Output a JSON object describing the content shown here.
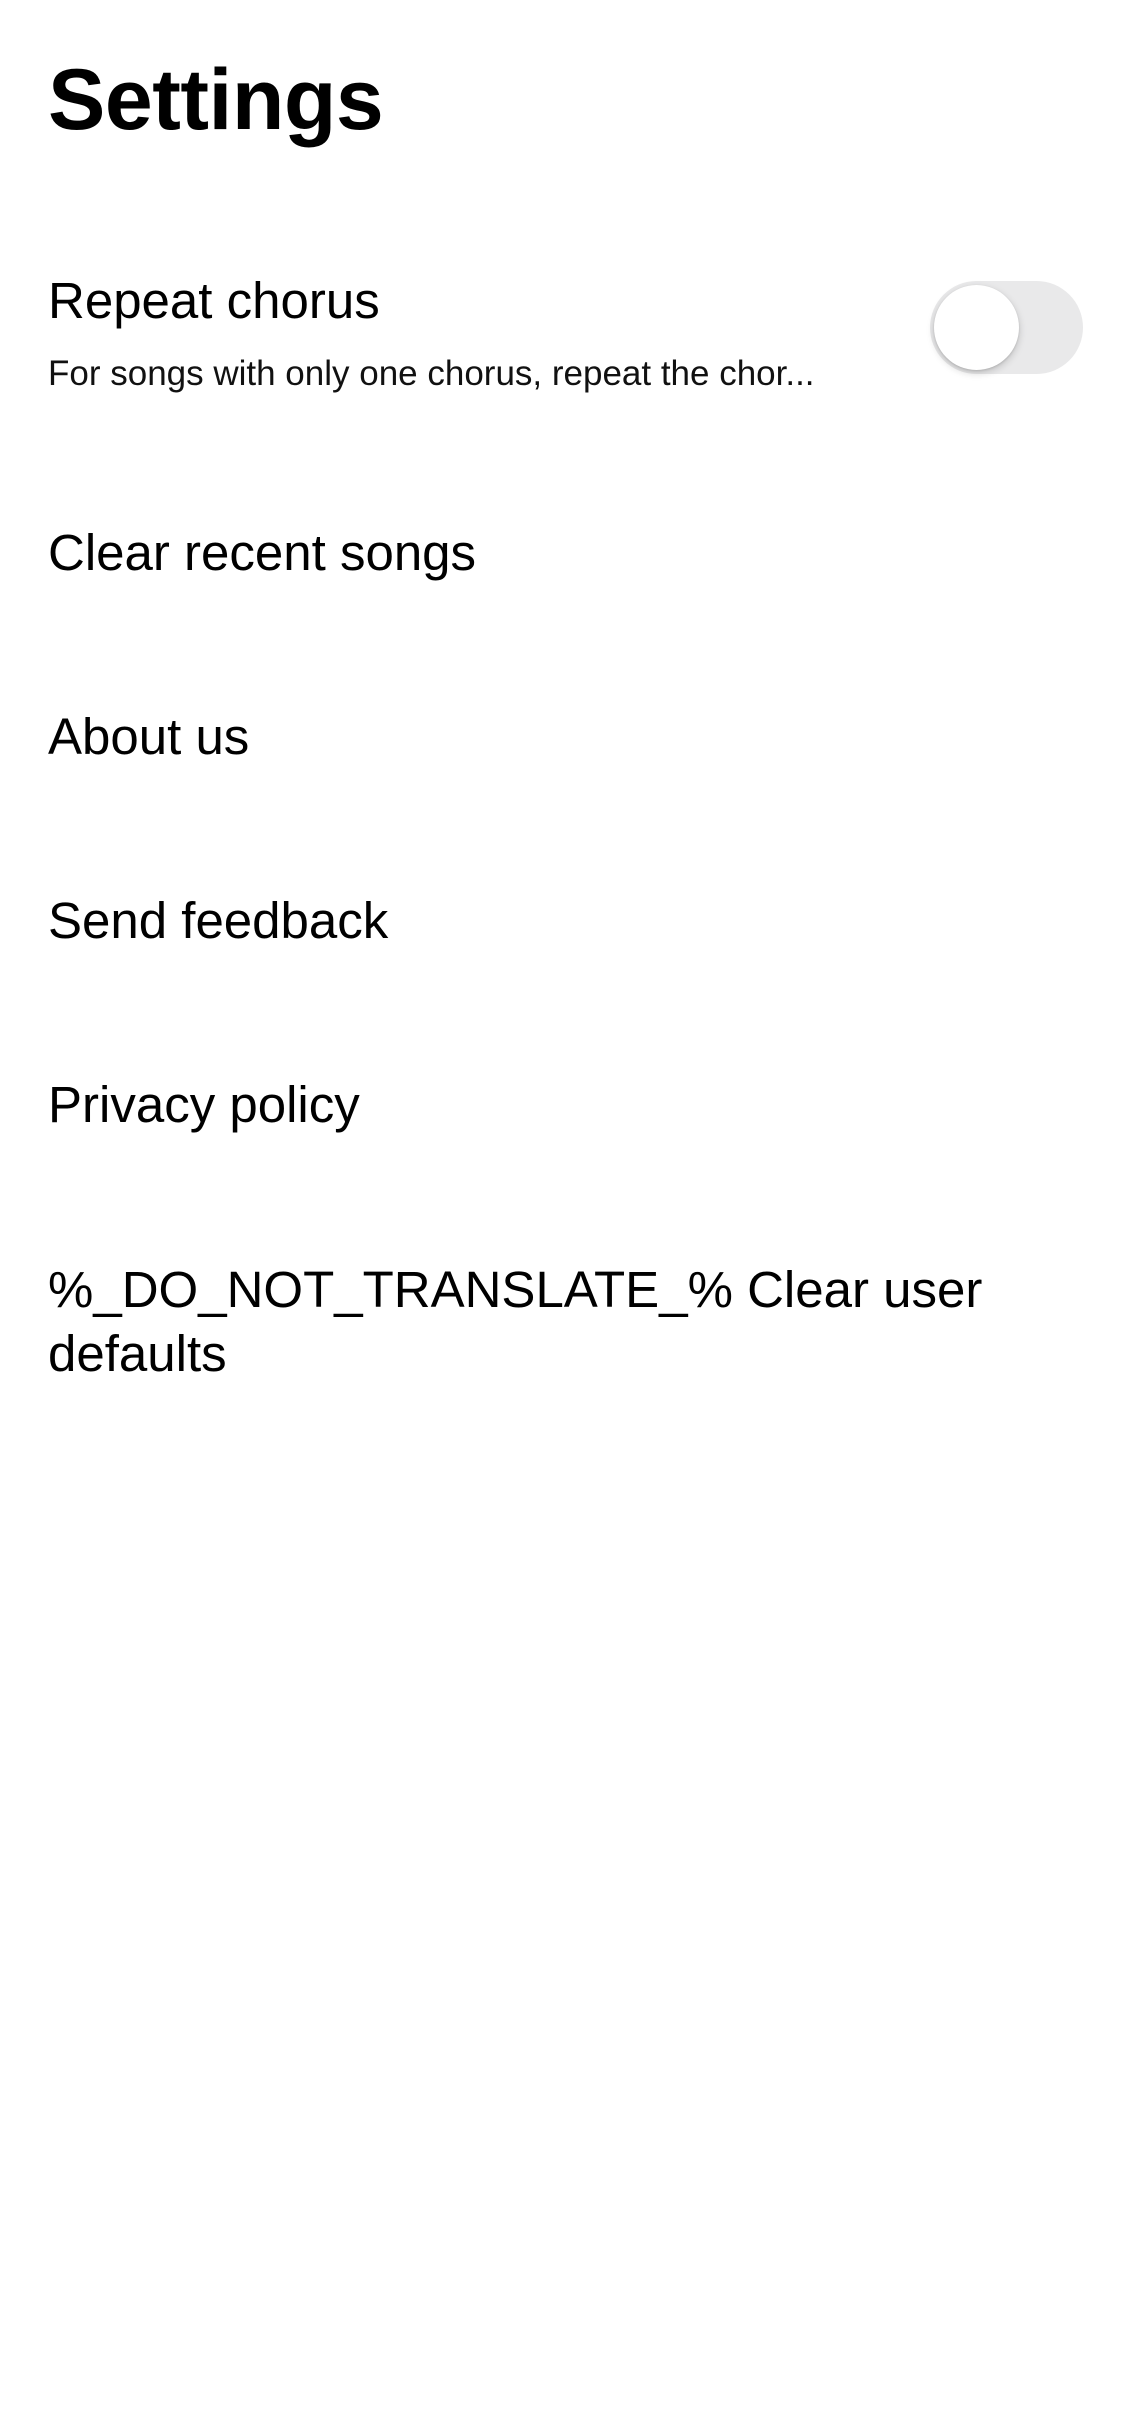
{
  "header": {
    "title": "Settings"
  },
  "settings": {
    "repeat_chorus": {
      "label": "Repeat chorus",
      "description": "For songs with only one chorus, repeat the chor...",
      "toggle_on": false
    },
    "clear_recent_songs": {
      "label": "Clear recent songs"
    },
    "about_us": {
      "label": "About us"
    },
    "send_feedback": {
      "label": "Send feedback"
    },
    "privacy_policy": {
      "label": "Privacy policy"
    },
    "clear_user_defaults": {
      "label": "%_DO_NOT_TRANSLATE_% Clear user defaults"
    }
  },
  "colors": {
    "background": "#ffffff",
    "text": "#000000",
    "toggle_off_track": "#e9e9ea",
    "toggle_knob": "#ffffff"
  }
}
